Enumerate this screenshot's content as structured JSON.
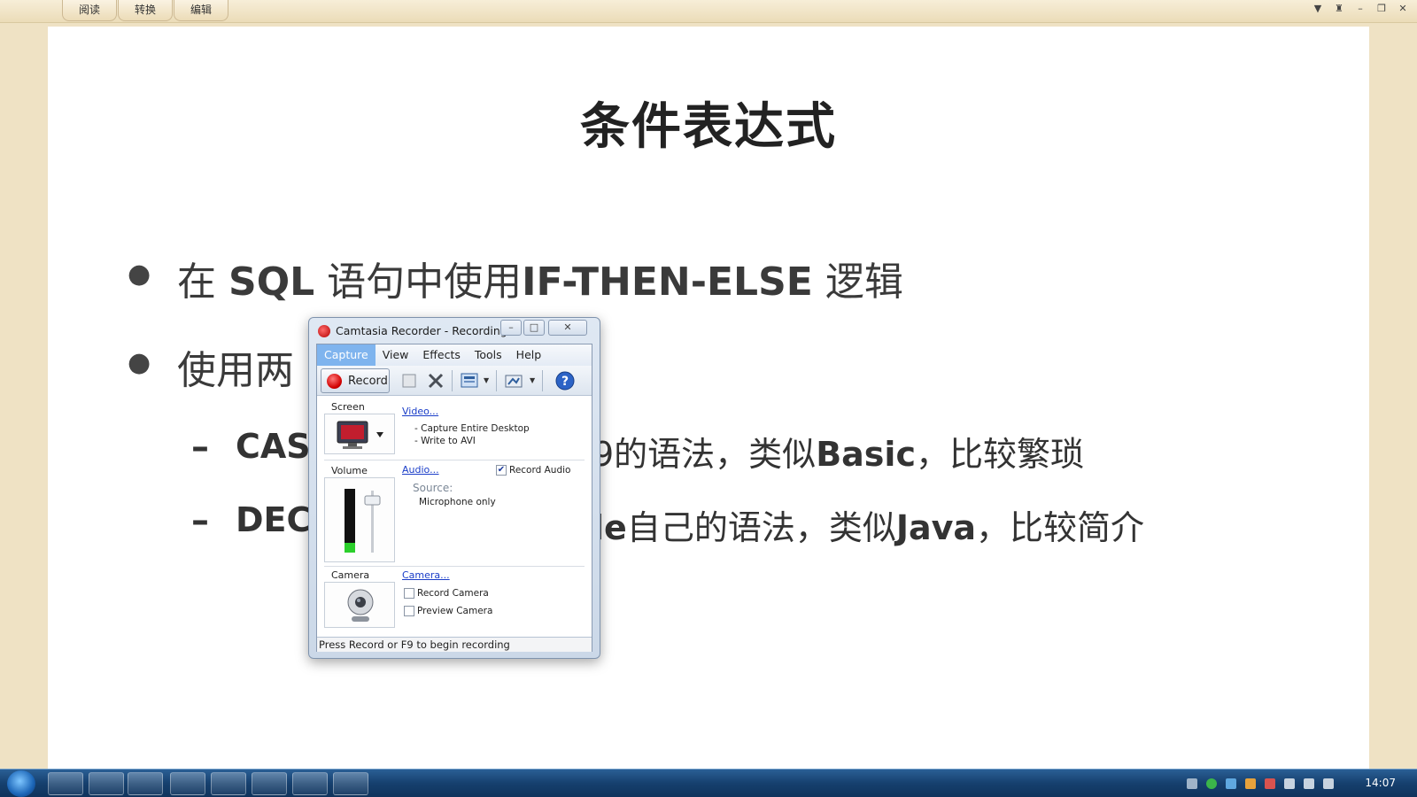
{
  "topbar": {
    "tabs": [
      {
        "label": "阅读"
      },
      {
        "label": "转换"
      },
      {
        "label": "编辑"
      }
    ]
  },
  "slide": {
    "title": "条件表达式",
    "bullet1": {
      "a": "在 ",
      "b": "SQL",
      "c": " 语句中使用",
      "d": "IF-THEN-ELSE",
      "e": " 逻辑"
    },
    "bullet2": {
      "visible": "使用两"
    },
    "sub1": {
      "a": "CAS",
      "b": "9的语法，类似",
      "c": "Basic",
      "d": "，比较繁琐"
    },
    "sub2": {
      "a": "DEC",
      "b": "le",
      "c": "自己的语法，类似",
      "d": "Java",
      "e": "，比较简介"
    },
    "dash": "–"
  },
  "dialog": {
    "title": "Camtasia Recorder - Recording",
    "menu": [
      {
        "label": "Capture",
        "active": true
      },
      {
        "label": "View"
      },
      {
        "label": "Effects"
      },
      {
        "label": "Tools"
      },
      {
        "label": "Help"
      }
    ],
    "record_label": "Record",
    "screen": {
      "label": "Screen",
      "link": "Video...",
      "line1": "- Capture Entire Desktop",
      "line2": "- Write to AVI"
    },
    "volume": {
      "label": "Volume",
      "link": "Audio...",
      "record_audio": "Record Audio",
      "source_label": "Source:",
      "source_value": "Microphone only",
      "level": 0.15
    },
    "camera": {
      "label": "Camera",
      "link": "Camera...",
      "record_camera": "Record Camera",
      "preview_camera": "Preview Camera"
    },
    "status": "Press Record or F9 to begin recording"
  },
  "taskbar": {
    "clock": "14:07"
  },
  "colors": {
    "accent": "#7fb4ee",
    "record_red": "#d10000",
    "link_blue": "#1a3dc8",
    "background_cream": "#efe2c4"
  }
}
